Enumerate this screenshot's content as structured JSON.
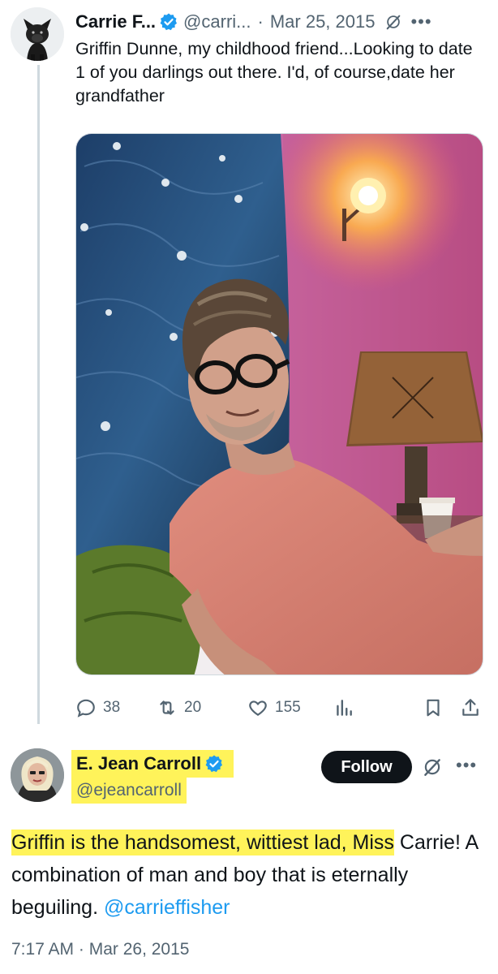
{
  "tweet1": {
    "display_name": "Carrie F...",
    "handle": "@carri...",
    "separator": "·",
    "date": "Mar 25, 2015",
    "text": "Griffin Dunne, my childhood friend...Looking to date 1 of you darlings out there. I'd, of course,date her grandfather",
    "stats": {
      "replies": "38",
      "reposts": "20",
      "likes": "155"
    },
    "icons": [
      "verified-badge-icon",
      "grok-icon",
      "more-icon",
      "reply-icon",
      "repost-icon",
      "like-icon",
      "views-icon",
      "bookmark-icon",
      "share-icon"
    ]
  },
  "tweet2": {
    "display_name": "E. Jean Carroll",
    "handle": "@ejeancarroll",
    "follow_label": "Follow",
    "text_highlighted": "Griffin is the handsomest, wittiest lad, Miss",
    "text_rest": " Carrie! A combination of man and boy that is eternally beguiling. ",
    "mention": "@carrieffisher",
    "timestamp": "7:17 AM · Mar 26, 2015"
  },
  "colors": {
    "text_primary": "#0f1419",
    "text_secondary": "#536471",
    "link": "#1d9bf0",
    "verified": "#1d9bf0",
    "highlight": "#fff35a",
    "follow_button": "#0f1419"
  }
}
